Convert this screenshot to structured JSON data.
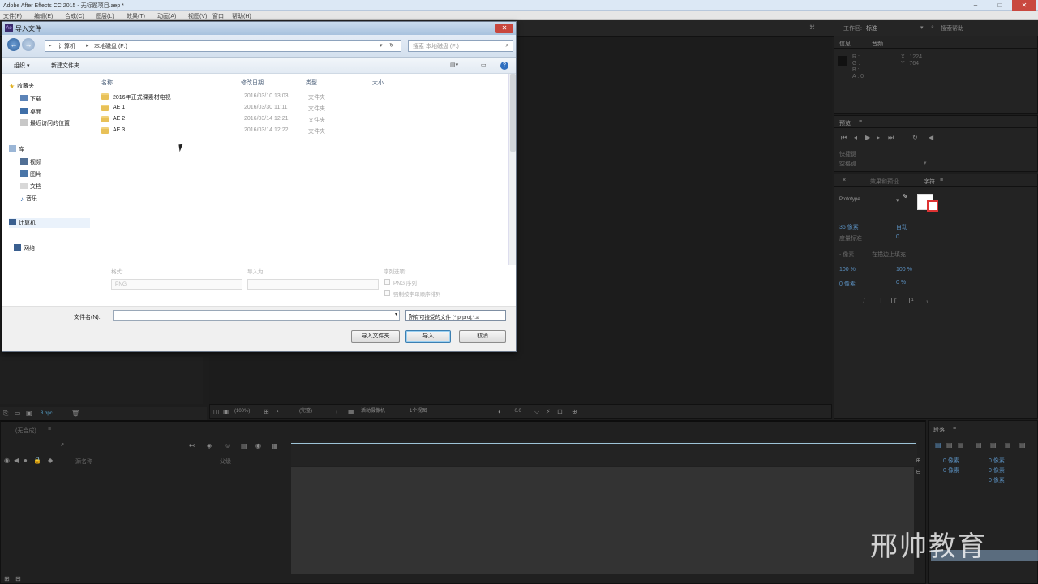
{
  "app": {
    "title": "Adobe After Effects CC 2015 - 无标题项目.aep *",
    "menu": [
      "文件(F)",
      "编辑(E)",
      "合成(C)",
      "图层(L)",
      "效果(T)",
      "动画(A)",
      "视图(V)",
      "窗口",
      "帮助(H)"
    ],
    "toolbar": {
      "workspace_label": "工作区:",
      "workspace_value": "标准",
      "search_help": "搜索帮助"
    }
  },
  "panels": {
    "info": {
      "tabs": [
        "信息",
        "音频"
      ],
      "readout": [
        "R :",
        "G :",
        "B :",
        "A : 0"
      ],
      "coords": [
        "X : 1224",
        "Y : 764"
      ]
    },
    "preview": {
      "title": "预览",
      "shortcut_label": "快捷键",
      "shortcut_value": "空格键"
    },
    "character": {
      "tabs": [
        "效果和预设",
        "字符"
      ],
      "font": "Prototype",
      "size": "36 像素",
      "leading": "自动",
      "metrics_label": "度量标准",
      "tracking": "0",
      "stroke": "- 像素",
      "stroke_mode": "在描边上填充",
      "scale_v": "100 %",
      "scale_h": "100 %",
      "baseline": "0 像素",
      "tsume": "0 %"
    },
    "timeline": {
      "layer_header": "源名称",
      "parent_header": "父级",
      "comp_tab": "(无合成)"
    },
    "paragraph": {
      "title": "段落",
      "values": [
        "0 像素",
        "0 像素",
        "0 像素",
        "0 像素",
        "0 像素"
      ]
    },
    "viewer_footer": {
      "zoom": "(100%)",
      "resolution": "(完整)",
      "camera": "活动摄像机",
      "views": "1个视图",
      "bits": "8 bpc"
    }
  },
  "dialog": {
    "title": "导入文件",
    "address": [
      "计算机",
      "本地磁盘 (F:)"
    ],
    "search_placeholder": "搜索 本地磁盘 (F:)",
    "commands": [
      "组织 ▾",
      "新建文件夹"
    ],
    "nav": {
      "favorites": "收藏夹",
      "favorites_items": [
        "下载",
        "桌面",
        "最近访问的位置"
      ],
      "libraries": "库",
      "library_items": [
        "视频",
        "图片",
        "文档",
        "音乐"
      ],
      "computer": "计算机",
      "network": "网络"
    },
    "columns": [
      "名称",
      "修改日期",
      "类型",
      "大小"
    ],
    "files": [
      {
        "name": "2016年正式课素材电视",
        "date": "2016/03/10 13:03",
        "type": "文件夹"
      },
      {
        "name": "AE 1",
        "date": "2016/03/30 11:11",
        "type": "文件夹"
      },
      {
        "name": "AE 2",
        "date": "2016/03/14 12:21",
        "type": "文件夹"
      },
      {
        "name": "AE 3",
        "date": "2016/03/14 12:22",
        "type": "文件夹"
      }
    ],
    "options": {
      "format_label": "格式:",
      "format_value": "PNG",
      "import_as_label": "导入为:",
      "sequence_label": "序列选项:",
      "sequence_check": "PNG 序列",
      "alpha_check": "强制按字母顺序排列"
    },
    "file_name_label": "文件名(N):",
    "file_name_value": "",
    "file_type_value": "所有可接受的文件 (*.prproj;*.a",
    "buttons": {
      "import_folder": "导入文件夹",
      "import": "导入",
      "cancel": "取消"
    }
  },
  "watermark": "邢帅教育"
}
